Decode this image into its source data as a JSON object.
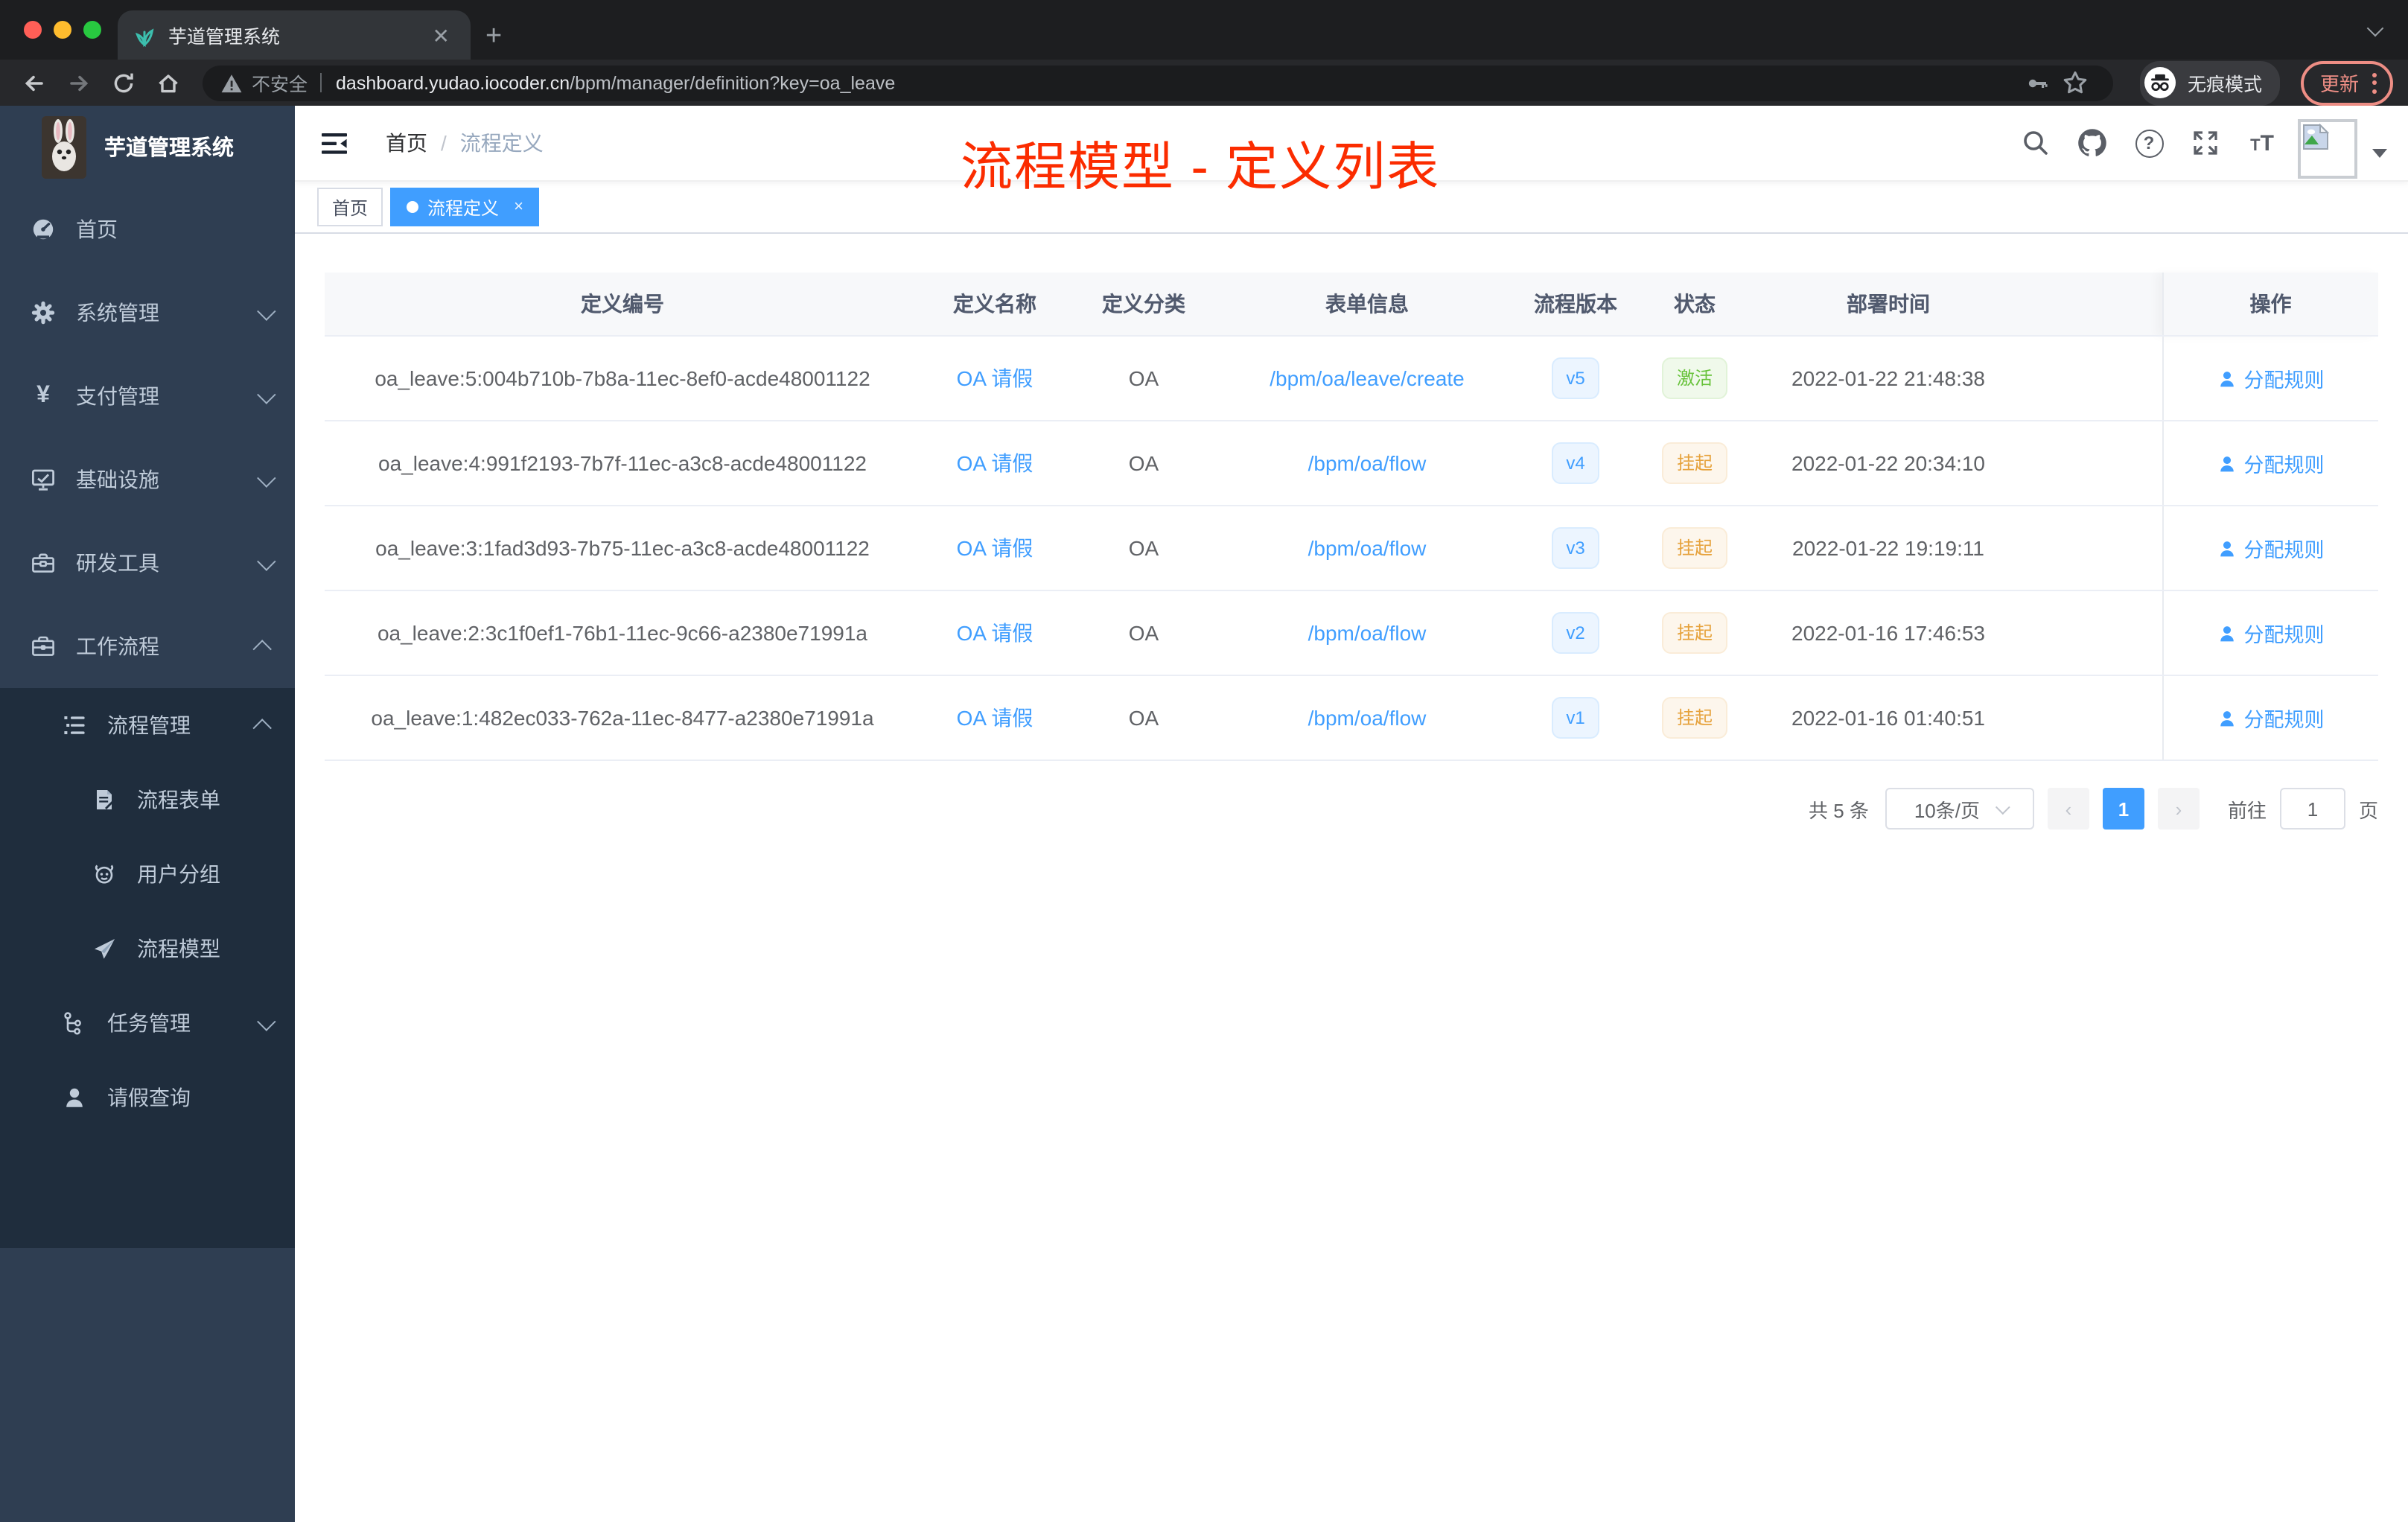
{
  "browser": {
    "tab_title": "芋道管理系统",
    "security_label": "不安全",
    "url_host": "dashboard.yudao.iocoder.cn",
    "url_path": "/bpm/manager/definition?key=oa_leave",
    "incognito_label": "无痕模式",
    "update_label": "更新"
  },
  "sidebar": {
    "app_title": "芋道管理系统",
    "menu": [
      {
        "label": "首页"
      },
      {
        "label": "系统管理"
      },
      {
        "label": "支付管理"
      },
      {
        "label": "基础设施"
      },
      {
        "label": "研发工具"
      },
      {
        "label": "工作流程"
      },
      {
        "label": "流程管理"
      },
      {
        "label": "流程表单"
      },
      {
        "label": "用户分组"
      },
      {
        "label": "流程模型"
      },
      {
        "label": "任务管理"
      },
      {
        "label": "请假查询"
      }
    ]
  },
  "header": {
    "breadcrumb_home": "首页",
    "breadcrumb_separator": "/",
    "breadcrumb_current": "流程定义",
    "annotation": "流程模型 - 定义列表"
  },
  "tags": {
    "home": "首页",
    "active": "流程定义",
    "close": "×"
  },
  "table": {
    "columns": [
      "定义编号",
      "定义名称",
      "定义分类",
      "表单信息",
      "流程版本",
      "状态",
      "部署时间",
      "操作"
    ],
    "rows": [
      {
        "id": "oa_leave:5:004b710b-7b8a-11ec-8ef0-acde48001122",
        "name": "OA 请假",
        "category": "OA",
        "form": "/bpm/oa/leave/create",
        "version": "v5",
        "status": "激活",
        "status_type": "success",
        "deploy_time": "2022-01-22 21:48:38",
        "action": "分配规则"
      },
      {
        "id": "oa_leave:4:991f2193-7b7f-11ec-a3c8-acde48001122",
        "name": "OA 请假",
        "category": "OA",
        "form": "/bpm/oa/flow",
        "version": "v4",
        "status": "挂起",
        "status_type": "warning",
        "deploy_time": "2022-01-22 20:34:10",
        "action": "分配规则"
      },
      {
        "id": "oa_leave:3:1fad3d93-7b75-11ec-a3c8-acde48001122",
        "name": "OA 请假",
        "category": "OA",
        "form": "/bpm/oa/flow",
        "version": "v3",
        "status": "挂起",
        "status_type": "warning",
        "deploy_time": "2022-01-22 19:19:11",
        "action": "分配规则"
      },
      {
        "id": "oa_leave:2:3c1f0ef1-76b1-11ec-9c66-a2380e71991a",
        "name": "OA 请假",
        "category": "OA",
        "form": "/bpm/oa/flow",
        "version": "v2",
        "status": "挂起",
        "status_type": "warning",
        "deploy_time": "2022-01-16 17:46:53",
        "action": "分配规则"
      },
      {
        "id": "oa_leave:1:482ec033-762a-11ec-8477-a2380e71991a",
        "name": "OA 请假",
        "category": "OA",
        "form": "/bpm/oa/flow",
        "version": "v1",
        "status": "挂起",
        "status_type": "warning",
        "deploy_time": "2022-01-16 01:40:51",
        "action": "分配规则"
      }
    ]
  },
  "pagination": {
    "total_label": "共 5 条",
    "page_size_label": "10条/页",
    "current_page": "1",
    "goto_label": "前往",
    "goto_value": "1",
    "page_unit_label": "页"
  },
  "colors": {
    "accent": "#409eff",
    "success": "#67c23a",
    "warning": "#e6a23c",
    "sidebar_bg": "#2f3e52",
    "submenu_bg": "#1f2d3d",
    "annotation_red": "#fb2c00",
    "active_tag": "#409eff"
  }
}
